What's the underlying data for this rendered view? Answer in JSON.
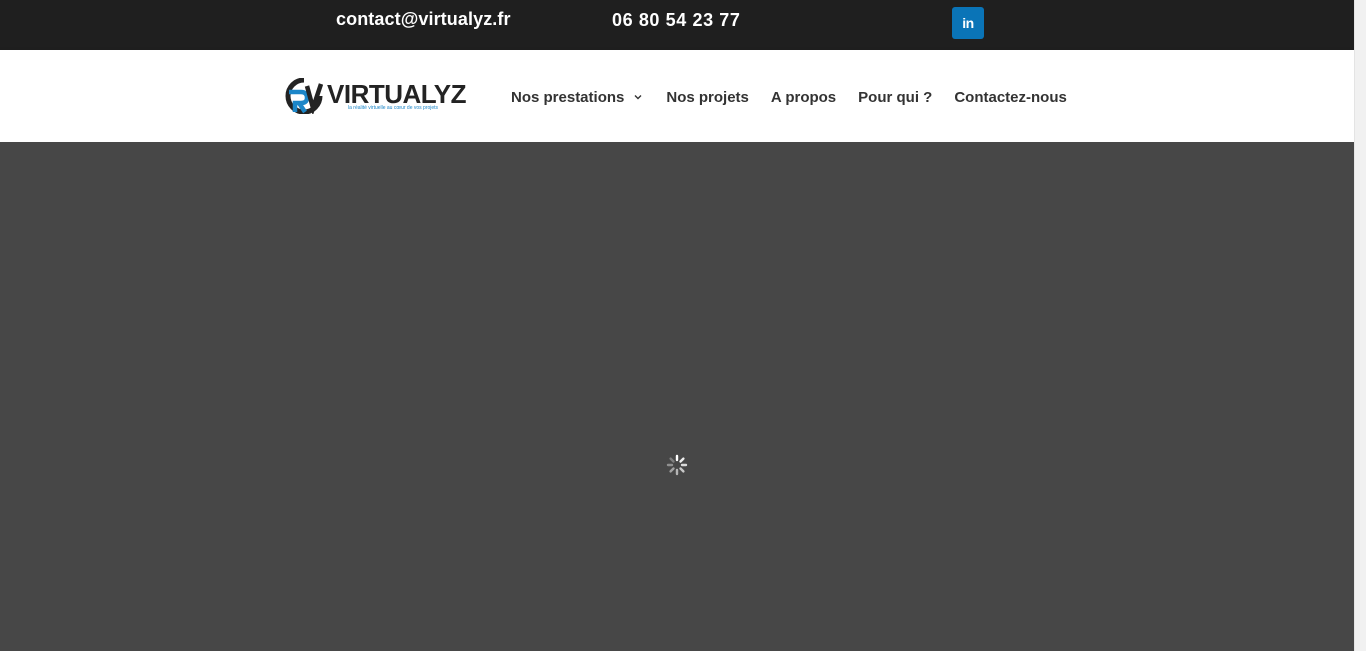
{
  "topbar": {
    "email": "contact@virtualyz.fr",
    "phone": "06 80 54 23 77",
    "social_icon": "linkedin-icon",
    "social_glyph": "in"
  },
  "header": {
    "logo": {
      "wordmark": "VIRTUALYZ",
      "tagline": "la réalité virtuelle au cœur de vos projets",
      "brand_colors": {
        "dark": "#232323",
        "blue": "#1c86c8"
      }
    },
    "nav": {
      "items": [
        {
          "label": "Nos prestations",
          "has_dropdown": true
        },
        {
          "label": "Nos projets"
        },
        {
          "label": "A propos"
        },
        {
          "label": "Pour qui ?"
        },
        {
          "label": "Contactez-nous"
        }
      ]
    }
  },
  "main": {
    "state": "loading",
    "spinner_icon": "loading-spinner-icon",
    "overlay_color": "#474747"
  },
  "colors": {
    "topbar_bg": "#1f1f1f",
    "linkedin_blue": "#0a74b7",
    "nav_text": "#333333"
  }
}
